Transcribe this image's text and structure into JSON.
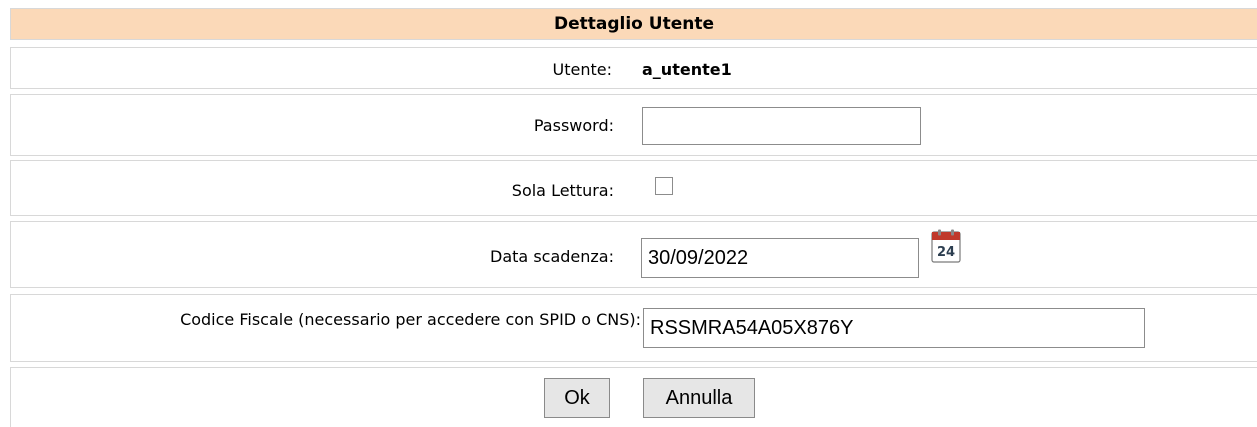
{
  "title": "Dettaglio Utente",
  "user": {
    "label": "Utente:",
    "value": "a_utente1"
  },
  "password": {
    "label": "Password:",
    "value": ""
  },
  "read_only": {
    "label": "Sola Lettura:",
    "checked": false
  },
  "expiry": {
    "label": "Data scadenza:",
    "value": "30/09/2022",
    "calendar_icon": "calendar-icon",
    "calendar_day": "24"
  },
  "fiscal_code": {
    "label": "Codice Fiscale (necessario per accedere con SPID o CNS):",
    "value": "RSSMRA54A05X876Y"
  },
  "buttons": {
    "ok": "Ok",
    "cancel": "Annulla"
  }
}
